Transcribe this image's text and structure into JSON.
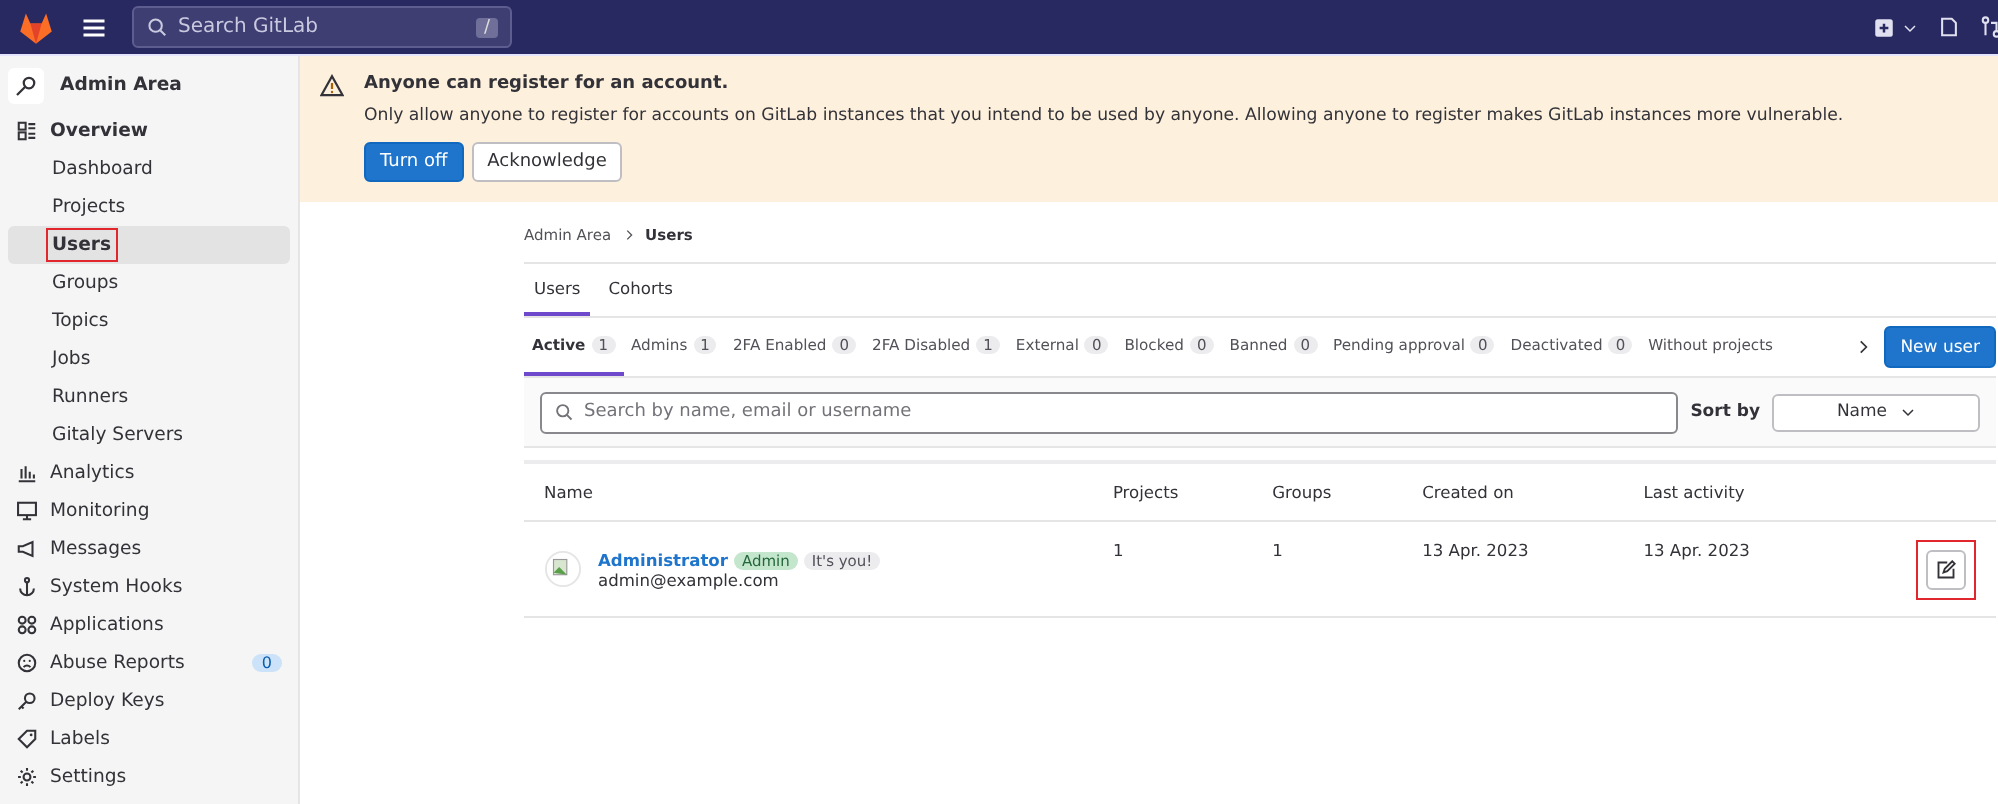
{
  "topbar": {
    "search": {
      "placeholder": "Search GitLab",
      "shortcut": "/"
    }
  },
  "sidebar": {
    "title": "Admin Area",
    "items": [
      {
        "label": "Overview",
        "selected": false,
        "children": [
          {
            "label": "Dashboard",
            "selected": false,
            "highlighted": false
          },
          {
            "label": "Projects",
            "selected": false,
            "highlighted": false
          },
          {
            "label": "Users",
            "selected": true,
            "highlighted": true
          },
          {
            "label": "Groups",
            "selected": false,
            "highlighted": false
          },
          {
            "label": "Topics",
            "selected": false,
            "highlighted": false
          },
          {
            "label": "Jobs",
            "selected": false,
            "highlighted": false
          },
          {
            "label": "Runners",
            "selected": false,
            "highlighted": false
          },
          {
            "label": "Gitaly Servers",
            "selected": false,
            "highlighted": false
          }
        ]
      },
      {
        "label": "Analytics",
        "selected": false
      },
      {
        "label": "Monitoring",
        "selected": false
      },
      {
        "label": "Messages",
        "selected": false
      },
      {
        "label": "System Hooks",
        "selected": false
      },
      {
        "label": "Applications",
        "selected": false
      },
      {
        "label": "Abuse Reports",
        "selected": false,
        "count": "0"
      },
      {
        "label": "Deploy Keys",
        "selected": false
      },
      {
        "label": "Labels",
        "selected": false
      },
      {
        "label": "Settings",
        "selected": false
      }
    ]
  },
  "alert": {
    "title": "Anyone can register for an account.",
    "message": "Only allow anyone to register for accounts on GitLab instances that you intend to be used by anyone. Allowing anyone to register makes GitLab instances more vulnerable.",
    "buttons": [
      {
        "label": "Turn off",
        "kind": "primary"
      },
      {
        "label": "Acknowledge",
        "kind": "secondary"
      }
    ]
  },
  "breadcrumbs": [
    "Admin Area",
    "Users"
  ],
  "tabs": [
    {
      "label": "Users",
      "selected": true
    },
    {
      "label": "Cohorts",
      "selected": false
    }
  ],
  "filters": [
    {
      "label": "Active",
      "count": "1",
      "selected": true
    },
    {
      "label": "Admins",
      "count": "1",
      "selected": false
    },
    {
      "label": "2FA Enabled",
      "count": "0",
      "selected": false
    },
    {
      "label": "2FA Disabled",
      "count": "1",
      "selected": false
    },
    {
      "label": "External",
      "count": "0",
      "selected": false
    },
    {
      "label": "Blocked",
      "count": "0",
      "selected": false
    },
    {
      "label": "Banned",
      "count": "0",
      "selected": false
    },
    {
      "label": "Pending approval",
      "count": "0",
      "selected": false
    },
    {
      "label": "Deactivated",
      "count": "0",
      "selected": false
    },
    {
      "label": "Without projects",
      "selected": false
    }
  ],
  "new_user_button": "New user",
  "search": {
    "placeholder": "Search by name, email or username"
  },
  "sort": {
    "label": "Sort by",
    "value": "Name"
  },
  "table": {
    "columns": [
      "Name",
      "Projects",
      "Groups",
      "Created on",
      "Last activity"
    ],
    "rows": [
      {
        "name": "Administrator",
        "badges": [
          {
            "label": "Admin",
            "kind": "success"
          },
          {
            "label": "It's you!",
            "kind": "neutral"
          }
        ],
        "email": "admin@example.com",
        "projects": "1",
        "groups": "1",
        "created_on": "13 Apr. 2023",
        "last_activity": "13 Apr. 2023",
        "edit_highlighted": true
      }
    ]
  }
}
